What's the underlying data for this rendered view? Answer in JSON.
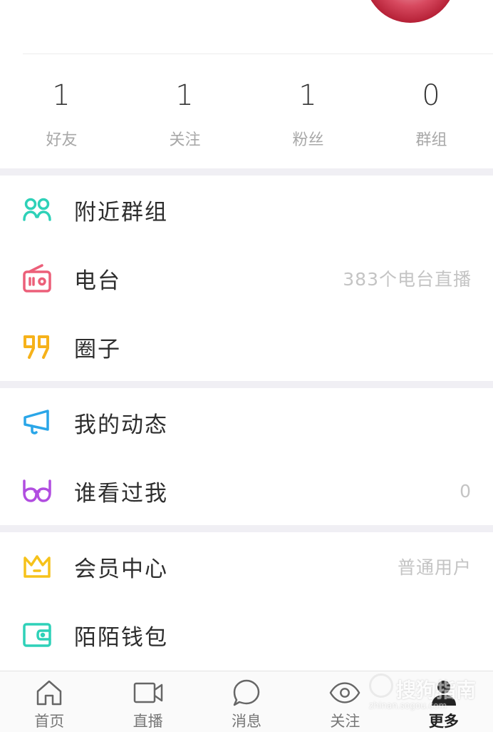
{
  "stats": [
    {
      "count": "1",
      "label": "好友"
    },
    {
      "count": "1",
      "label": "关注"
    },
    {
      "count": "1",
      "label": "粉丝"
    },
    {
      "count": "0",
      "label": "群组"
    }
  ],
  "menu": {
    "nearby_groups": {
      "label": "附近群组",
      "icon": "people-icon",
      "color": "#2ed1b8"
    },
    "radio": {
      "label": "电台",
      "value": "383个电台直播",
      "icon": "radio-icon",
      "color": "#ec5f79"
    },
    "circle": {
      "label": "圈子",
      "icon": "quote-icon",
      "color": "#f6b21a"
    },
    "my_feed": {
      "label": "我的动态",
      "icon": "megaphone-icon",
      "color": "#2aa6e8"
    },
    "visitors": {
      "label": "谁看过我",
      "value": "0",
      "icon": "glasses-icon",
      "color": "#b14de0"
    },
    "vip": {
      "label": "会员中心",
      "value": "普通用户",
      "icon": "crown-icon",
      "color": "#f6c21a"
    },
    "wallet": {
      "label": "陌陌钱包",
      "icon": "wallet-icon",
      "color": "#2ed1b8"
    }
  },
  "tabbar": [
    {
      "label": "首页",
      "icon": "home-icon"
    },
    {
      "label": "直播",
      "icon": "video-camera-icon"
    },
    {
      "label": "消息",
      "icon": "chat-bubble-icon"
    },
    {
      "label": "关注",
      "icon": "eye-icon"
    },
    {
      "label": "更多",
      "icon": "person-icon",
      "active": true
    }
  ],
  "watermark": {
    "text": "搜狗指南",
    "sub": "zhinan.sogou.com"
  }
}
